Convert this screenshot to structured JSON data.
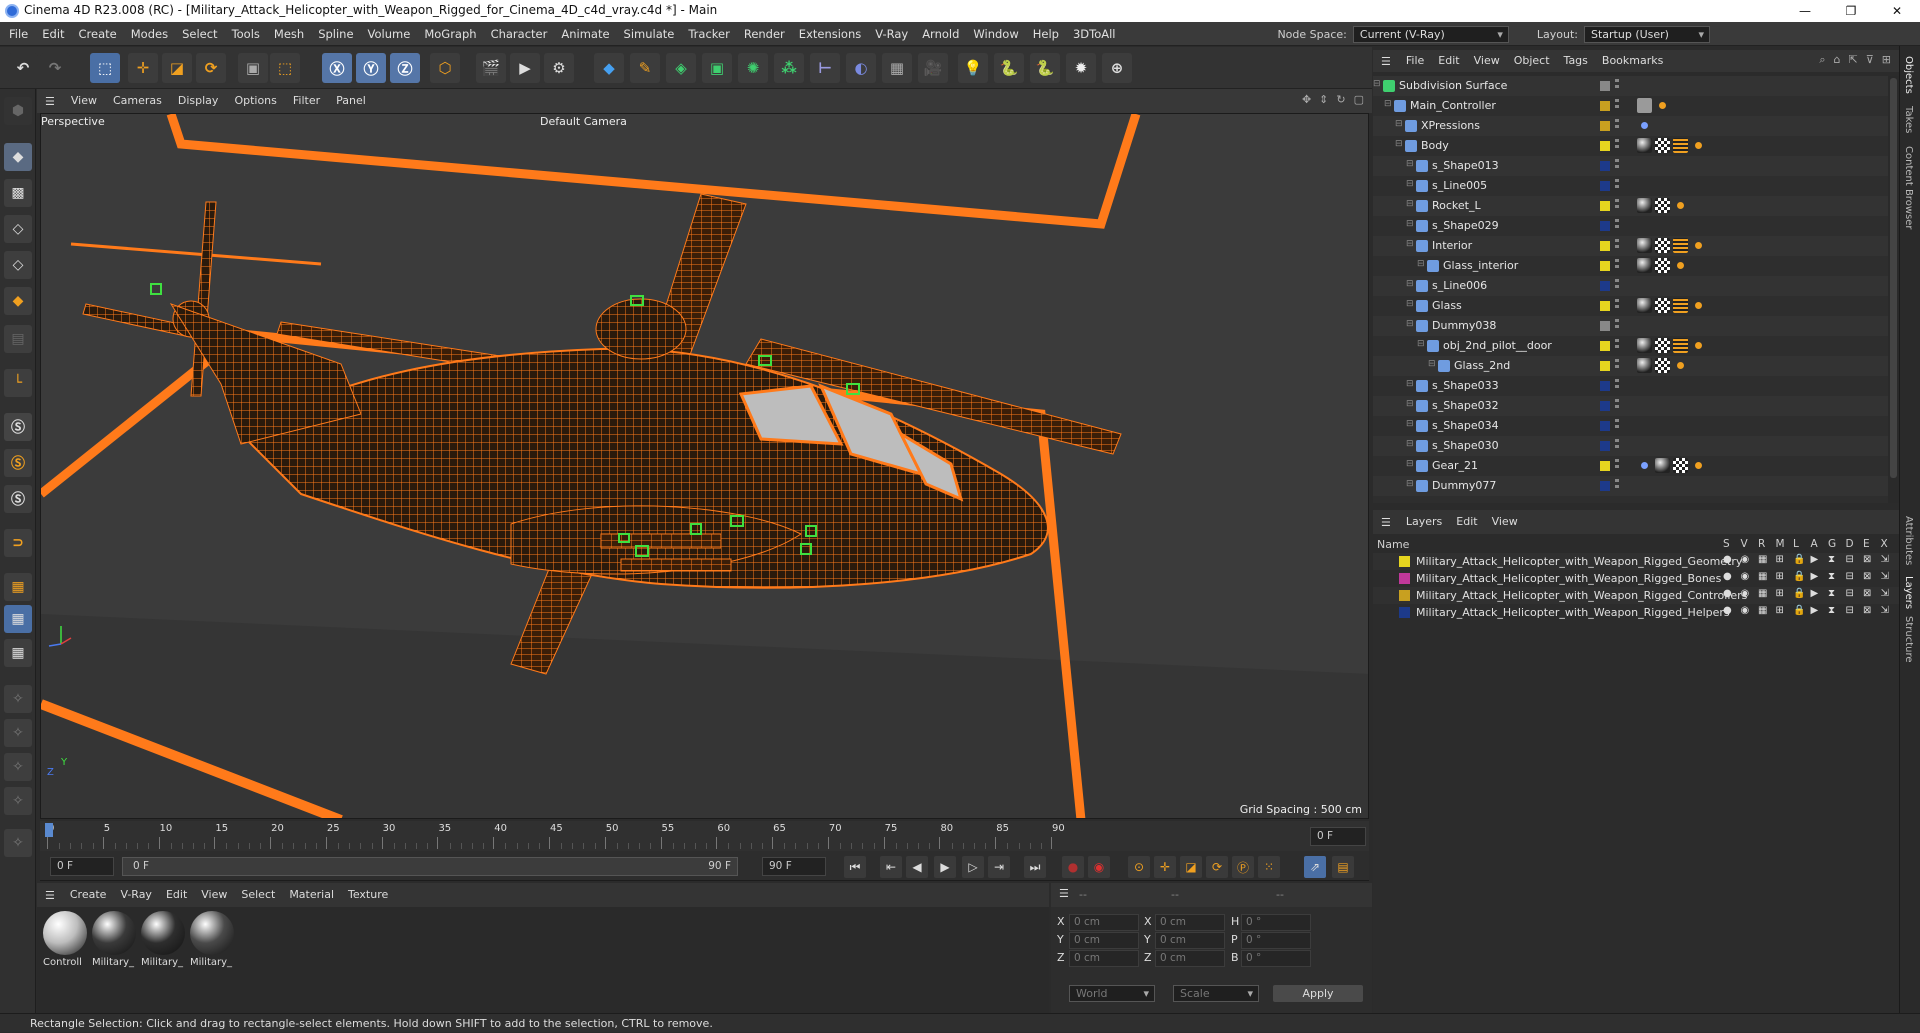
{
  "window": {
    "title": "Cinema 4D R23.008 (RC) - [Military_Attack_Helicopter_with_Weapon_Rigged_for_Cinema_4D_c4d_vray.c4d *] - Main",
    "minimize": "—",
    "maximize": "❐",
    "close": "✕"
  },
  "menu": [
    "File",
    "Edit",
    "Create",
    "Modes",
    "Select",
    "Tools",
    "Mesh",
    "Spline",
    "Volume",
    "MoGraph",
    "Character",
    "Animate",
    "Simulate",
    "Tracker",
    "Render",
    "Extensions",
    "V-Ray",
    "Arnold",
    "Window",
    "Help",
    "3DToAll"
  ],
  "nodespace": {
    "label": "Node Space:",
    "value": "Current (V-Ray)"
  },
  "layout": {
    "label": "Layout:",
    "value": "Startup (User)"
  },
  "viewport": {
    "menu": [
      "View",
      "Cameras",
      "Display",
      "Options",
      "Filter",
      "Panel"
    ],
    "view_name": "Perspective",
    "camera": "Default Camera",
    "grid_spacing": "Grid Spacing : 500 cm"
  },
  "timeline": {
    "ticks": [
      "0",
      "5",
      "10",
      "15",
      "20",
      "25",
      "30",
      "35",
      "40",
      "45",
      "50",
      "55",
      "60",
      "65",
      "70",
      "75",
      "80",
      "85",
      "90"
    ],
    "current_frame": "0 F"
  },
  "controls": {
    "start": "0 F",
    "range_start": "0 F",
    "range_end": "90 F",
    "end": "90 F"
  },
  "materials": {
    "menu": [
      "Create",
      "V-Ray",
      "Edit",
      "View",
      "Select",
      "Material",
      "Texture"
    ],
    "items": [
      {
        "label": "Controll",
        "color": "#bdbdbd"
      },
      {
        "label": "Military_",
        "color": "#3a3a3a"
      },
      {
        "label": "Military_",
        "color": "#2e2e2e"
      },
      {
        "label": "Military_",
        "color": "#4a4a4a"
      }
    ]
  },
  "coordinates": {
    "headers": [
      "--",
      "--",
      "--"
    ],
    "rows": [
      {
        "a": "X",
        "av": "0 cm",
        "b": "X",
        "bv": "0 cm",
        "c": "H",
        "cv": "0 °"
      },
      {
        "a": "Y",
        "av": "0 cm",
        "b": "Y",
        "bv": "0 cm",
        "c": "P",
        "cv": "0 °"
      },
      {
        "a": "Z",
        "av": "0 cm",
        "b": "Z",
        "bv": "0 cm",
        "c": "B",
        "cv": "0 °"
      }
    ],
    "mode1": "World",
    "mode2": "Scale",
    "apply": "Apply"
  },
  "status": "Rectangle Selection: Click and drag to rectangle-select elements. Hold down SHIFT to add to the selection, CTRL to remove.",
  "objects": {
    "menu": [
      "File",
      "Edit",
      "View",
      "Object",
      "Tags",
      "Bookmarks"
    ],
    "rows": [
      {
        "name": "Subdivision Surface",
        "indent": 0,
        "layer": "#888888",
        "tags": []
      },
      {
        "name": "Main_Controller",
        "indent": 1,
        "layer": "#c8a020",
        "tags": [
          "sphere",
          "dots"
        ]
      },
      {
        "name": "XPressions",
        "indent": 2,
        "layer": "#c8a020",
        "tags": [
          "xp"
        ]
      },
      {
        "name": "Body",
        "indent": 2,
        "layer": "#e6d51f",
        "tags": [
          "ball",
          "check",
          "grid",
          "dots"
        ]
      },
      {
        "name": "s_Shape013",
        "indent": 3,
        "layer": "#1d3a8a",
        "tags": []
      },
      {
        "name": "s_Line005",
        "indent": 3,
        "layer": "#1d3a8a",
        "tags": []
      },
      {
        "name": "Rocket_L",
        "indent": 3,
        "layer": "#e6d51f",
        "tags": [
          "ball",
          "check",
          "dots"
        ]
      },
      {
        "name": "s_Shape029",
        "indent": 3,
        "layer": "#1d3a8a",
        "tags": []
      },
      {
        "name": "Interior",
        "indent": 3,
        "layer": "#e6d51f",
        "tags": [
          "ball",
          "check",
          "grid",
          "dots"
        ]
      },
      {
        "name": "Glass_interior",
        "indent": 4,
        "layer": "#e6d51f",
        "tags": [
          "ball",
          "check",
          "dots"
        ]
      },
      {
        "name": "s_Line006",
        "indent": 3,
        "layer": "#1d3a8a",
        "tags": []
      },
      {
        "name": "Glass",
        "indent": 3,
        "layer": "#e6d51f",
        "tags": [
          "ball",
          "check",
          "grid",
          "dots"
        ]
      },
      {
        "name": "Dummy038",
        "indent": 3,
        "layer": "#888888",
        "tags": []
      },
      {
        "name": "obj_2nd_pilot__door",
        "indent": 4,
        "layer": "#e6d51f",
        "tags": [
          "ball",
          "check",
          "grid",
          "dots"
        ]
      },
      {
        "name": "Glass_2nd",
        "indent": 5,
        "layer": "#e6d51f",
        "tags": [
          "ball",
          "check",
          "dots"
        ]
      },
      {
        "name": "s_Shape033",
        "indent": 3,
        "layer": "#1d3a8a",
        "tags": []
      },
      {
        "name": "s_Shape032",
        "indent": 3,
        "layer": "#1d3a8a",
        "tags": []
      },
      {
        "name": "s_Shape034",
        "indent": 3,
        "layer": "#1d3a8a",
        "tags": []
      },
      {
        "name": "s_Shape030",
        "indent": 3,
        "layer": "#1d3a8a",
        "tags": []
      },
      {
        "name": "Gear_21",
        "indent": 3,
        "layer": "#e6d51f",
        "tags": [
          "xp",
          "ball",
          "check",
          "dots"
        ]
      },
      {
        "name": "Dummy077",
        "indent": 3,
        "layer": "#1d3a8a",
        "tags": []
      }
    ]
  },
  "layers": {
    "menu": [
      "Layers",
      "Edit",
      "View"
    ],
    "header": {
      "name": "Name",
      "cols": [
        "S",
        "V",
        "R",
        "M",
        "L",
        "A",
        "G",
        "D",
        "E",
        "X"
      ]
    },
    "rows": [
      {
        "name": "Military_Attack_Helicopter_with_Weapon_Rigged_Geometry",
        "color": "#e6d51f"
      },
      {
        "name": "Military_Attack_Helicopter_with_Weapon_Rigged_Bones",
        "color": "#c0389a"
      },
      {
        "name": "Military_Attack_Helicopter_with_Weapon_Rigged_Controllers",
        "color": "#c8a020"
      },
      {
        "name": "Military_Attack_Helicopter_with_Weapon_Rigged_Helpers",
        "color": "#1d3a8a"
      }
    ]
  },
  "right_tabs": [
    "Objects",
    "Takes",
    "Content Browser",
    "Attributes",
    "Layers",
    "Structure"
  ]
}
